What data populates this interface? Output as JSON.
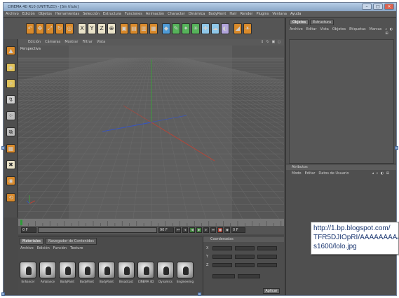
{
  "window": {
    "title": "CINEMA 4D R10 (UNTITLED) - [Sin título]"
  },
  "menubar": [
    "Archivo",
    "Edición",
    "Objetos",
    "Herramientas",
    "Selección",
    "Estructura",
    "Funciones",
    "Animación",
    "Character",
    "Dinámica",
    "BodyPaint",
    "Hair",
    "Render",
    "Plugins",
    "Ventana",
    "Ayuda"
  ],
  "viewport": {
    "menu": [
      "Edición",
      "Cámaras",
      "Mostrar",
      "Filtrar",
      "Vista"
    ],
    "label": "Perspectiva",
    "header_icons": "⇕ ↻ ▣ ◻"
  },
  "transport": {
    "start": "0 F",
    "end": "90 F",
    "frame": "0 F"
  },
  "materials": {
    "tabs": [
      {
        "label": "Materiales",
        "active": true
      },
      {
        "label": "Navegador de Contenidos",
        "active": false
      }
    ],
    "menu": [
      "Archivo",
      "Edición",
      "Función",
      "Texture"
    ],
    "items": [
      "Enhancer",
      "Ambiance",
      "BodyPaint",
      "BodyPaint",
      "BodyPaint",
      "Broadcast",
      "CINEMA 4D",
      "Dynamics",
      "Engineering"
    ]
  },
  "coords": {
    "header": "Coordenadas",
    "rows": [
      "X",
      "Y",
      "Z"
    ],
    "apply_label": "Aplicar"
  },
  "right_panel": {
    "tabs": [
      {
        "label": "Objetos",
        "active": true
      },
      {
        "label": "Estructura",
        "active": false
      }
    ],
    "menu": [
      "Archivo",
      "Editar",
      "Vista",
      "Objetos",
      "Etiquetas",
      "Marcas"
    ],
    "menu_icons": "⌕ ◐ ⊞",
    "attributes": {
      "header": "Atributos",
      "menu": [
        "Modo",
        "Editar",
        "Datos de Usuario"
      ],
      "icons": "◂ ⌕ ◐ ⊞"
    }
  },
  "tooltip": {
    "lines": [
      "http://1.bp.blogspot.com/",
      "TFR5DJIOpRI/AAAAAAAAAA",
      "s1600/lolo.jpg"
    ]
  }
}
